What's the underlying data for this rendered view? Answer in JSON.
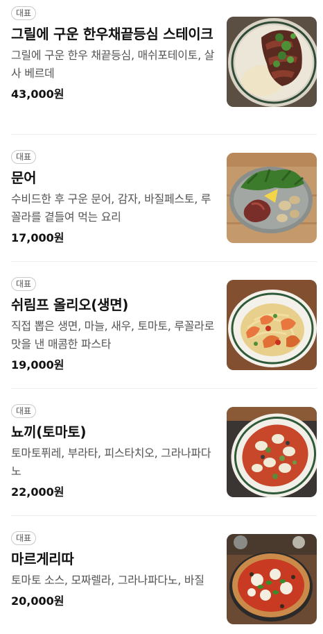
{
  "menu": {
    "items": [
      {
        "badge": "대표",
        "name": "그릴에 구운 한우채끝등심 스테이크",
        "description": "그릴에 구운 한우 채끝등심, 매쉬포테이토, 살사 베르데",
        "price": "43,000원",
        "image": "steak-photo"
      },
      {
        "badge": "대표",
        "name": "문어",
        "description": "수비드한 후 구운 문어, 감자, 바질페스토, 루꼴라를 곁들여 먹는 요리",
        "price": "17,000원",
        "image": "octopus-photo"
      },
      {
        "badge": "대표",
        "name": "쉬림프 올리오(생면)",
        "description": "직접 뽑은 생면, 마늘, 새우, 토마토, 루꼴라로 맛을 낸 매콤한 파스타",
        "price": "19,000원",
        "image": "shrimp-pasta-photo"
      },
      {
        "badge": "대표",
        "name": "뇨끼(토마토)",
        "description": "토마토퓌레, 부라타, 피스타치오, 그라나파다노",
        "price": "22,000원",
        "image": "gnocchi-photo"
      },
      {
        "badge": "대표",
        "name": "마르게리따",
        "description": "토마토 소스, 모짜렐라, 그라나파다노, 바질",
        "price": "20,000원",
        "image": "pizza-photo"
      }
    ]
  }
}
